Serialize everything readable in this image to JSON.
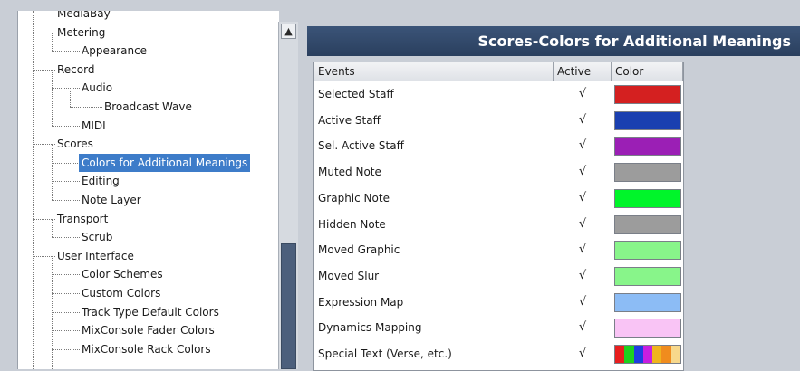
{
  "tree": {
    "items": [
      {
        "label": "MediaBay",
        "level": 1
      },
      {
        "label": "Metering",
        "level": 1
      },
      {
        "label": "Appearance",
        "level": 2
      },
      {
        "label": "Record",
        "level": 1
      },
      {
        "label": "Audio",
        "level": 2
      },
      {
        "label": "Broadcast Wave",
        "level": 3
      },
      {
        "label": "MIDI",
        "level": 2
      },
      {
        "label": "Scores",
        "level": 1
      },
      {
        "label": "Colors for Additional Meanings",
        "level": 2,
        "selected": true
      },
      {
        "label": "Editing",
        "level": 2
      },
      {
        "label": "Note Layer",
        "level": 2
      },
      {
        "label": "Transport",
        "level": 1
      },
      {
        "label": "Scrub",
        "level": 2
      },
      {
        "label": "User Interface",
        "level": 1
      },
      {
        "label": "Color Schemes",
        "level": 2
      },
      {
        "label": "Custom Colors",
        "level": 2
      },
      {
        "label": "Track Type Default Colors",
        "level": 2
      },
      {
        "label": "MixConsole Fader Colors",
        "level": 2
      },
      {
        "label": "MixConsole Rack Colors",
        "level": 2
      }
    ]
  },
  "scrollbar": {
    "up_arrow_icon": "chevron-up-icon"
  },
  "page": {
    "title": "Scores-Colors for Additional Meanings"
  },
  "table": {
    "headers": {
      "events": "Events",
      "active": "Active",
      "color": "Color"
    },
    "rows": [
      {
        "event": "Selected Staff",
        "active": "√",
        "color": "#d42020"
      },
      {
        "event": "Active Staff",
        "active": "√",
        "color": "#1a3fb0"
      },
      {
        "event": "Sel. Active Staff",
        "active": "√",
        "color": "#9b1fb5"
      },
      {
        "event": "Muted Note",
        "active": "√",
        "color": "#9c9c9c"
      },
      {
        "event": "Graphic Note",
        "active": "√",
        "color": "#00f52a"
      },
      {
        "event": "Hidden Note",
        "active": "√",
        "color": "#9c9c9c"
      },
      {
        "event": "Moved Graphic",
        "active": "√",
        "color": "#88f58a"
      },
      {
        "event": "Moved Slur",
        "active": "√",
        "color": "#88f58a"
      },
      {
        "event": "Expression Map",
        "active": "√",
        "color": "#8cbcf5"
      },
      {
        "event": "Dynamics Mapping",
        "active": "√",
        "color": "#f9c4f5"
      },
      {
        "event": "Special Text (Verse, etc.)",
        "active": "√",
        "colors": [
          "#e81e1e",
          "#1ed11e",
          "#1e3ee0",
          "#c81ee0",
          "#f0b41e",
          "#f08c1e",
          "#f7d88c"
        ]
      }
    ]
  },
  "colors": {
    "header_bg": "#2f4565",
    "selection": "#3d7cc9",
    "scroll_thumb": "#4c5f7c"
  }
}
